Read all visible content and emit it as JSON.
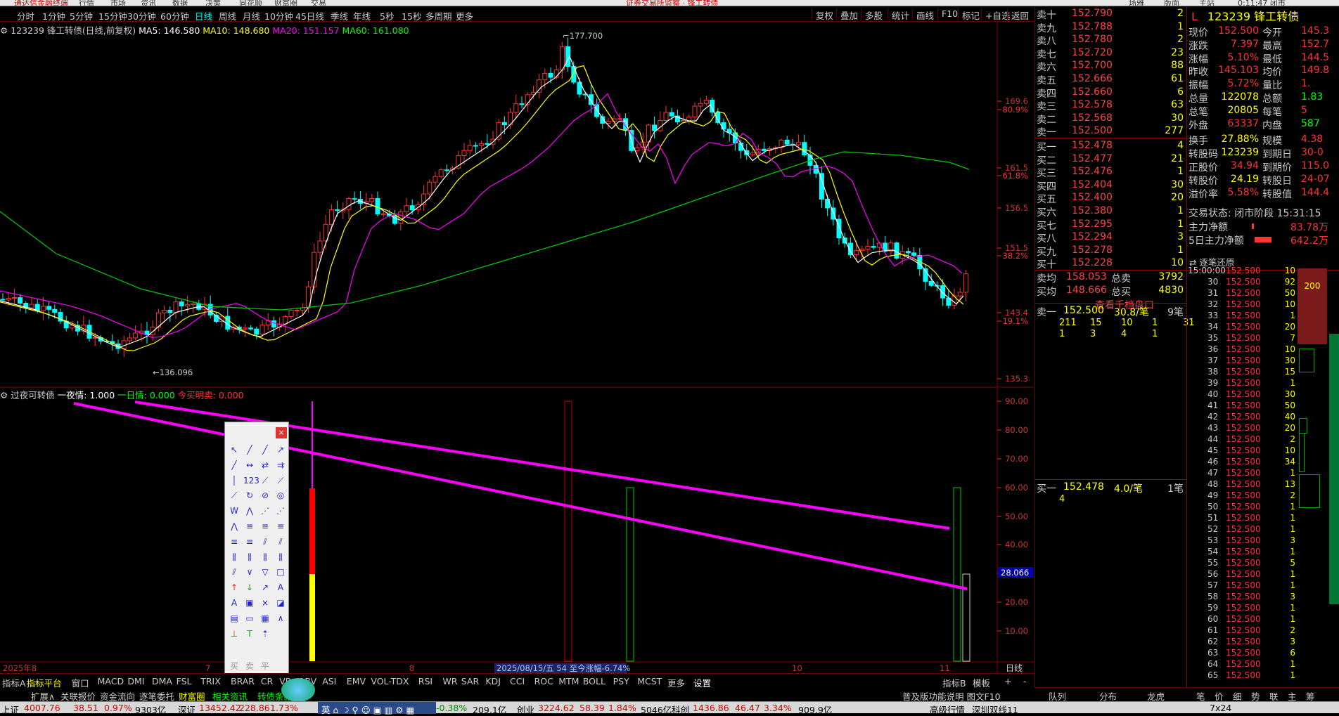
{
  "topbar": {
    "left": "通达信金融终端",
    "m1": "行情",
    "m2": "市场",
    "m3": "资讯",
    "m4": "数据",
    "m5": "决策",
    "m6": "同花顺",
    "m7": "财富圈",
    "m8": "交易",
    "notice": "证券交易所监察 · 锋工转债",
    "right1": "场雅",
    "right2": "版面",
    "right3": "主站",
    "right4": "0:11:47 闭市"
  },
  "period": {
    "items": [
      "分时",
      "1分钟",
      "5分钟",
      "15分钟",
      "30分钟",
      "60分钟",
      "日线",
      "周线",
      "月线",
      "10分钟",
      "45日线",
      "季线",
      "年线",
      "5秒",
      "15秒",
      "多周期",
      "更多"
    ],
    "selected": "日线",
    "tools": [
      "复权",
      "叠加",
      "多股",
      "统计",
      "画线",
      "F10",
      "标记",
      "+自选",
      "返回"
    ]
  },
  "info": {
    "name": "123239 锋工转债(日线,前复权)",
    "ma5": "MA5: 146.580",
    "ma10": "MA10: 148.680",
    "ma20": "MA20: 151.157",
    "ma60": "MA60: 161.080",
    "hi": "177.700",
    "lo": "136.096"
  },
  "price_axis": [
    "169.6",
    "80.9%",
    "161.5",
    "61.8%",
    "156.5",
    "151.5",
    "38.2%",
    "143.4",
    "19.1%",
    "135.3"
  ],
  "sub": {
    "title": "过夜可转债",
    "a": "一夜情: 1.000",
    "b": "一日情: 0.000",
    "c": "今买明卖: 0.000",
    "axis": [
      "90.00",
      "80.00",
      "70.00",
      "60.00",
      "50.00",
      "40.00",
      "30.00",
      "20.00",
      "10.00"
    ],
    "tag": "28.066"
  },
  "xaxis": {
    "y": "2025年8",
    "m7": "7",
    "m8": "8",
    "m10": "10",
    "m11": "11",
    "tip": "2025/08/15/五 54 至今涨幅-6.74%",
    "right": "日线"
  },
  "orderbook": {
    "asks": [
      [
        "卖十",
        "152.790",
        "2"
      ],
      [
        "卖九",
        "152.788",
        "1"
      ],
      [
        "卖八",
        "152.780",
        "2"
      ],
      [
        "卖七",
        "152.720",
        "23"
      ],
      [
        "卖六",
        "152.700",
        "88"
      ],
      [
        "卖五",
        "152.666",
        "61"
      ],
      [
        "卖四",
        "152.660",
        "6"
      ],
      [
        "卖三",
        "152.578",
        "63"
      ],
      [
        "卖二",
        "152.568",
        "30"
      ],
      [
        "卖一",
        "152.500",
        "277"
      ]
    ],
    "bids": [
      [
        "买一",
        "152.478",
        "4"
      ],
      [
        "买二",
        "152.477",
        "21"
      ],
      [
        "买三",
        "152.476",
        "1"
      ],
      [
        "买四",
        "152.404",
        "30"
      ],
      [
        "买五",
        "152.400",
        "20"
      ],
      [
        "买六",
        "152.380",
        "1"
      ],
      [
        "买七",
        "152.295",
        "1"
      ],
      [
        "买八",
        "152.294",
        "3"
      ],
      [
        "买九",
        "152.278",
        "1"
      ],
      [
        "买十",
        "152.228",
        "10"
      ]
    ],
    "avg_sell": "158.053",
    "total_sell": "3792",
    "avg_buy": "148.666",
    "total_buy": "4830",
    "sell_lbl": "卖均",
    "buy_lbl": "买均",
    "ts_lbl": "总卖",
    "tb_lbl": "总买",
    "qdl": "查看千档盘口"
  },
  "quote": {
    "code": "L",
    "title": "123239 锋工转债",
    "rows": [
      [
        "现价",
        "152.500",
        "今开",
        "145.3"
      ],
      [
        "涨跌",
        "7.397",
        "最高",
        "152.7"
      ],
      [
        "涨幅",
        "5.10%",
        "最低",
        "144.5"
      ],
      [
        "昨收",
        "145.103",
        "均价",
        "149.8"
      ],
      [
        "振幅",
        "5.72%",
        "量比",
        "1."
      ],
      [
        "总量",
        "122078",
        "总额",
        "1.83"
      ],
      [
        "总笔",
        "20805",
        "每笔",
        "5"
      ],
      [
        "外盘",
        "63337",
        "内盘",
        "587"
      ],
      [
        "换手",
        "27.88%",
        "规模",
        "4.38"
      ],
      [
        "转股码",
        "123239",
        "到期日",
        "30-0"
      ],
      [
        "正股价",
        "34.94",
        "到期价",
        "115.0"
      ],
      [
        "转股价",
        "24.19",
        "转股日",
        "24-07"
      ],
      [
        "溢价率",
        "5.58%",
        "转股值",
        "144.4"
      ]
    ],
    "status": "交易状态: 闭市阶段 15:31:15",
    "zl": "主力净额",
    "zl_v": "83.78万",
    "zl5": "5日主力净额",
    "zl5_v": "642.2万"
  },
  "level2": {
    "a1": "卖一",
    "a1p": "152.500",
    "a1v": "30.8/笔",
    "a1n": "9笔",
    "q1": [
      "211",
      "15",
      "10",
      "1",
      "31"
    ],
    "q2": [
      "1",
      "3",
      "4",
      "1"
    ],
    "b1": "买一",
    "b1p": "152.478",
    "b1v": "4.0/笔",
    "b1n": "1笔",
    "b1q": "4"
  },
  "tape": {
    "title": "逐笔还原",
    "rows": [
      [
        "15:00:00",
        "152.500",
        "10"
      ],
      [
        "30",
        "152.500",
        "92"
      ],
      [
        "31",
        "152.500",
        "50"
      ],
      [
        "32",
        "152.500",
        "10"
      ],
      [
        "33",
        "152.500",
        "1"
      ],
      [
        "34",
        "152.500",
        "20"
      ],
      [
        "35",
        "152.500",
        "7"
      ],
      [
        "36",
        "152.500",
        "10"
      ],
      [
        "37",
        "152.500",
        "30"
      ],
      [
        "38",
        "152.500",
        "15"
      ],
      [
        "39",
        "152.500",
        "1"
      ],
      [
        "40",
        "152.500",
        "30"
      ],
      [
        "41",
        "152.500",
        "50"
      ],
      [
        "42",
        "152.500",
        "40"
      ],
      [
        "43",
        "152.500",
        "20"
      ],
      [
        "44",
        "152.500",
        "2"
      ],
      [
        "45",
        "152.500",
        "10"
      ],
      [
        "46",
        "152.500",
        "34"
      ],
      [
        "47",
        "152.500",
        "1"
      ],
      [
        "48",
        "152.500",
        "13"
      ],
      [
        "49",
        "152.500",
        "2"
      ],
      [
        "50",
        "152.500",
        "1"
      ],
      [
        "51",
        "152.500",
        "1"
      ],
      [
        "52",
        "152.500",
        "1"
      ],
      [
        "53",
        "152.500",
        "3"
      ],
      [
        "54",
        "152.500",
        "1"
      ],
      [
        "55",
        "152.500",
        "5"
      ],
      [
        "56",
        "152.500",
        "1"
      ],
      [
        "57",
        "152.500",
        "1"
      ],
      [
        "58",
        "152.500",
        "3"
      ],
      [
        "59",
        "152.500",
        "1"
      ],
      [
        "60",
        "152.500",
        "1"
      ],
      [
        "61",
        "152.500",
        "2"
      ],
      [
        "62",
        "152.500",
        "3"
      ],
      [
        "63",
        "152.500",
        "6"
      ],
      [
        "64",
        "152.500",
        "1"
      ],
      [
        "65",
        "152.500",
        "1"
      ]
    ],
    "bar": "200"
  },
  "ind": [
    "指标A",
    "指标平台",
    "窗口",
    "MACD",
    "DMI",
    "DMA",
    "FSL",
    "TRIX",
    "BRAR",
    "CR",
    "VR",
    "OBV",
    "ASI",
    "EMV",
    "VOL-TDX",
    "RSI",
    "WR",
    "SAR",
    "KDJ",
    "CCI",
    "ROC",
    "MTM",
    "BOLL",
    "PSY",
    "MCST",
    "更多",
    "设置"
  ],
  "ind_r": [
    "指标B",
    "模板",
    "+",
    "-"
  ],
  "tabs2": [
    "扩展∧",
    "关联报价",
    "资金流向",
    "逐笔委托",
    "财富圈",
    "相关资讯",
    "转债条款"
  ],
  "tabs2_r": "普及版功能说明 图文F10",
  "rtabs": [
    "队列",
    "分布",
    "龙虎",
    "笔",
    "价",
    "细",
    "势",
    "联",
    "主",
    "筹"
  ],
  "status": {
    "sh": "上证",
    "sh_v": "4007.76",
    "sh_c": "38.51",
    "sh_p": "0.97%",
    "sh_a": "9303亿",
    "sz": "深证",
    "sz_v": "13452.42",
    "sz_c": "228.86",
    "sz_p": "1.73%",
    "cy": "创业",
    "cy_v": "3224.62",
    "cy_c": "58.39",
    "cy_p": "1.84%",
    "cy_a": "5046亿",
    "kc": "科创",
    "kc_v": "1436.86",
    "kc_c": "46.47",
    "kc_p": "3.34%",
    "kc_a": "909.9亿",
    "hq": "高级行情",
    "sz2": "深圳双线11",
    "sz_a": "209.1亿",
    "dim": "7x24",
    "x": "-0.38%"
  }
}
